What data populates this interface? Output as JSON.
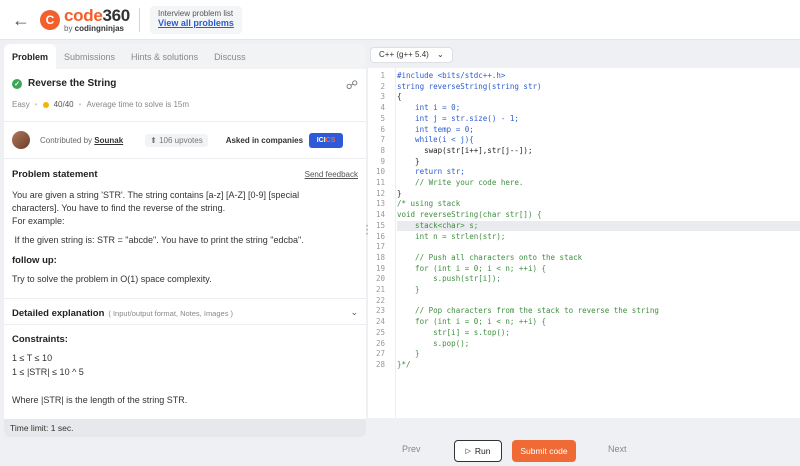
{
  "header": {
    "logo_main": "code",
    "logo_number": "360",
    "logo_sub_prefix": "by ",
    "logo_sub_brand": "codingninjas",
    "info_label": "Interview problem list",
    "info_link": "View all problems",
    "back_icon": "arrow-left-icon",
    "brand_color": "#f25f2b"
  },
  "tabs": [
    "Problem",
    "Submissions",
    "Hints & solutions",
    "Discuss"
  ],
  "problem": {
    "title": "Reverse the String",
    "difficulty": "Easy",
    "score": "40/40",
    "avg_time": "Average time to solve is 15m",
    "contributed_by_label": "Contributed by",
    "contributor": "Sounak",
    "upvotes": "106 upvotes",
    "asked_label": "Asked in companies",
    "company_badge_a": "ICI",
    "company_badge_b": "CS",
    "statement_head": "Problem statement",
    "send_feedback": "Send feedback",
    "statement_lines": [
      "You are given a string 'STR'. The string contains [a-z] [A-Z] [0-9] [special",
      "characters]. You have to find the reverse of the string.",
      "For example:"
    ],
    "example_line": " If the given string is: STR = \"abcde\". You have to print the string \"edcba\".",
    "follow_up_head": "follow up:",
    "follow_up_text": "Try to solve the problem in O(1) space complexity.",
    "detailed_head": "Detailed explanation",
    "detailed_note": "( Input/output format, Notes, Images )",
    "constraints_head": "Constraints:",
    "constraint_1": "1 ≤ T ≤ 10",
    "constraint_2": "1 ≤ |STR| ≤ 10 ^ 5",
    "where_text": "Where |STR| is the length of the string STR.",
    "time_limit": "Time limit: 1 sec."
  },
  "editor": {
    "language": "C++ (g++ 5.4)",
    "highlight_line": 15,
    "lines": [
      "#include <bits/stdc++.h>",
      "string reverseString(string str)",
      "{",
      "    int i = 0;",
      "    int j = str.size() - 1;",
      "    int temp = 0;",
      "    while(i < j){",
      "      swap(str[i++],str[j--]);",
      "    }",
      "    return str;",
      "    // Write your code here.",
      "}",
      "/* using stack",
      "void reverseString(char str[]) {",
      "    stack<char> s;",
      "    int n = strlen(str);",
      "",
      "    // Push all characters onto the stack",
      "    for (int i = 0; i < n; ++i) {",
      "        s.push(str[i]);",
      "    }",
      "",
      "    // Pop characters from the stack to reverse the string",
      "    for (int i = 0; i < n; ++i) {",
      "        str[i] = s.top();",
      "        s.pop();",
      "    }",
      "}*/"
    ]
  },
  "footer": {
    "prev": "Prev",
    "run": "Run",
    "submit": "Submit code",
    "next": "Next",
    "submit_color": "#f06a35"
  }
}
